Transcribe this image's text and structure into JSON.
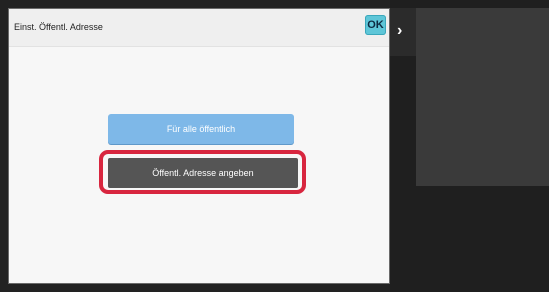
{
  "dialog": {
    "title": "Einst. Öffentl. Adresse",
    "ok_label": "OK"
  },
  "options": {
    "public_all_label": "Für alle öffentlich",
    "specify_public_label": "Öffentl. Adresse angeben"
  },
  "side": {
    "toggle_icon": "chevron-right-icon",
    "toggle_glyph": "›"
  },
  "colors": {
    "ok_accent": "#5ec6d8",
    "option_blue": "#7eb8e8",
    "option_selected": "#555555",
    "highlight_red": "#d8263f"
  }
}
